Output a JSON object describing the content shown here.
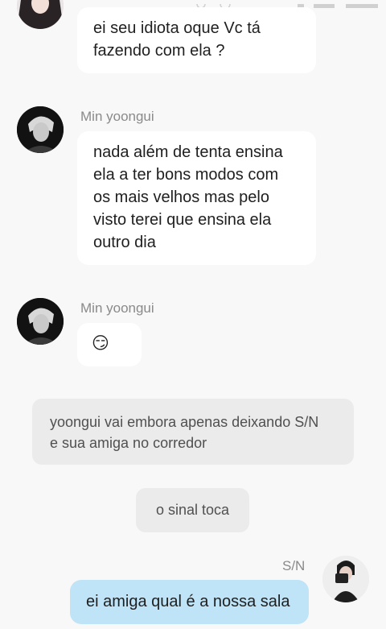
{
  "chat": {
    "messages": [
      {
        "text": "ei seu idiota oque Vc tá\nfazendo com ela ?"
      },
      {
        "sender": "Min yoongui",
        "text": "nada além de tenta ensina\nela a ter bons modos com\nos mais velhos mas pelo\nvisto terei que ensina ela\noutro dia"
      },
      {
        "sender": "Min yoongui",
        "text": "😏"
      }
    ],
    "narrations": [
      {
        "text": "yoongui vai embora apenas deixando S/N\ne sua amiga no corredor"
      },
      {
        "text": "o sinal toca"
      }
    ],
    "own_message": {
      "sender": "S/N",
      "text": "ei amiga qual é a nossa sala"
    }
  },
  "colors": {
    "background": "#f8f8f8",
    "bubble": "#ffffff",
    "narration": "#ebebeb",
    "own_bubble": "#bfe4f7"
  }
}
